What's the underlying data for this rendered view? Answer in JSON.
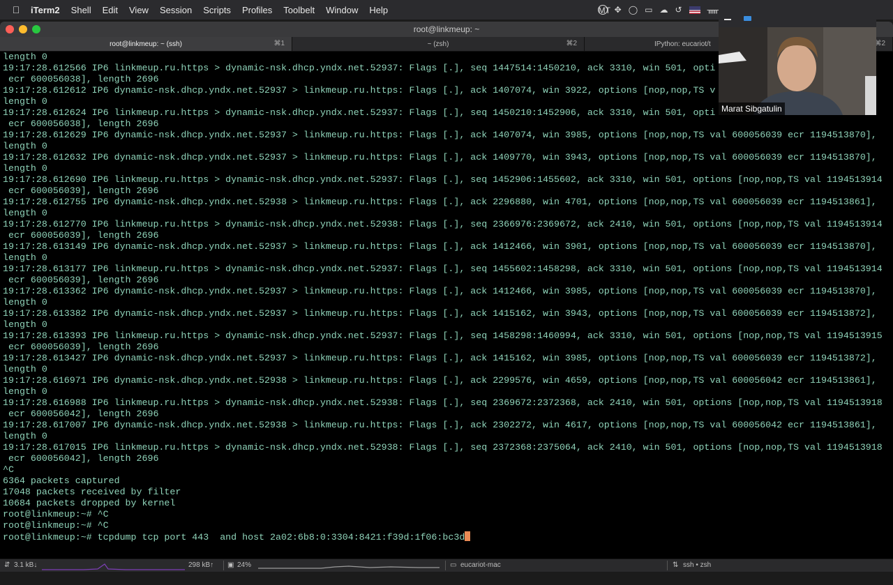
{
  "menubar": {
    "app_name": "iTerm2",
    "items": [
      "Shell",
      "Edit",
      "View",
      "Session",
      "Scripts",
      "Profiles",
      "Toolbelt",
      "Window",
      "Help"
    ],
    "status_badge": "MT"
  },
  "window": {
    "title": "root@linkmeup: ~"
  },
  "tabs": [
    {
      "label": "root@linkmeup: ~ (ssh)",
      "shortcut": "⌘1"
    },
    {
      "label": "~ (zsh)",
      "shortcut": "⌘2"
    },
    {
      "label": "IPython: eucariot/t",
      "shortcut": "⌘2"
    }
  ],
  "terminal": {
    "lines": [
      "length 0",
      "19:17:28.612566 IP6 linkmeup.ru.https > dynamic-nsk.dhcp.yndx.net.52937: Flags [.], seq 1447514:1450210, ack 3310, win 501, opti",
      " ecr 600056038], length 2696",
      "19:17:28.612612 IP6 dynamic-nsk.dhcp.yndx.net.52937 > linkmeup.ru.https: Flags [.], ack 1407074, win 3922, options [nop,nop,TS v",
      "length 0",
      "19:17:28.612624 IP6 linkmeup.ru.https > dynamic-nsk.dhcp.yndx.net.52937: Flags [.], seq 1450210:1452906, ack 3310, win 501, opti",
      " ecr 600056038], length 2696",
      "19:17:28.612629 IP6 dynamic-nsk.dhcp.yndx.net.52937 > linkmeup.ru.https: Flags [.], ack 1407074, win 3985, options [nop,nop,TS val 600056039 ecr 1194513870],",
      "length 0",
      "19:17:28.612632 IP6 dynamic-nsk.dhcp.yndx.net.52937 > linkmeup.ru.https: Flags [.], ack 1409770, win 3943, options [nop,nop,TS val 600056039 ecr 1194513870],",
      "length 0",
      "19:17:28.612690 IP6 linkmeup.ru.https > dynamic-nsk.dhcp.yndx.net.52937: Flags [.], seq 1452906:1455602, ack 3310, win 501, options [nop,nop,TS val 1194513914",
      " ecr 600056039], length 2696",
      "19:17:28.612755 IP6 dynamic-nsk.dhcp.yndx.net.52938 > linkmeup.ru.https: Flags [.], ack 2296880, win 4701, options [nop,nop,TS val 600056039 ecr 1194513861],",
      "length 0",
      "19:17:28.612770 IP6 linkmeup.ru.https > dynamic-nsk.dhcp.yndx.net.52938: Flags [.], seq 2366976:2369672, ack 2410, win 501, options [nop,nop,TS val 1194513914",
      " ecr 600056039], length 2696",
      "19:17:28.613149 IP6 dynamic-nsk.dhcp.yndx.net.52937 > linkmeup.ru.https: Flags [.], ack 1412466, win 3901, options [nop,nop,TS val 600056039 ecr 1194513870],",
      "length 0",
      "19:17:28.613177 IP6 linkmeup.ru.https > dynamic-nsk.dhcp.yndx.net.52937: Flags [.], seq 1455602:1458298, ack 3310, win 501, options [nop,nop,TS val 1194513914",
      " ecr 600056039], length 2696",
      "19:17:28.613362 IP6 dynamic-nsk.dhcp.yndx.net.52937 > linkmeup.ru.https: Flags [.], ack 1412466, win 3985, options [nop,nop,TS val 600056039 ecr 1194513870],",
      "length 0",
      "19:17:28.613382 IP6 dynamic-nsk.dhcp.yndx.net.52937 > linkmeup.ru.https: Flags [.], ack 1415162, win 3943, options [nop,nop,TS val 600056039 ecr 1194513872],",
      "length 0",
      "19:17:28.613393 IP6 linkmeup.ru.https > dynamic-nsk.dhcp.yndx.net.52937: Flags [.], seq 1458298:1460994, ack 3310, win 501, options [nop,nop,TS val 1194513915",
      " ecr 600056039], length 2696",
      "19:17:28.613427 IP6 dynamic-nsk.dhcp.yndx.net.52937 > linkmeup.ru.https: Flags [.], ack 1415162, win 3985, options [nop,nop,TS val 600056039 ecr 1194513872],",
      "length 0",
      "19:17:28.616971 IP6 dynamic-nsk.dhcp.yndx.net.52938 > linkmeup.ru.https: Flags [.], ack 2299576, win 4659, options [nop,nop,TS val 600056042 ecr 1194513861],",
      "length 0",
      "19:17:28.616988 IP6 linkmeup.ru.https > dynamic-nsk.dhcp.yndx.net.52938: Flags [.], seq 2369672:2372368, ack 2410, win 501, options [nop,nop,TS val 1194513918",
      " ecr 600056042], length 2696",
      "19:17:28.617007 IP6 dynamic-nsk.dhcp.yndx.net.52938 > linkmeup.ru.https: Flags [.], ack 2302272, win 4617, options [nop,nop,TS val 600056042 ecr 1194513861],",
      "length 0",
      "19:17:28.617015 IP6 linkmeup.ru.https > dynamic-nsk.dhcp.yndx.net.52938: Flags [.], seq 2372368:2375064, ack 2410, win 501, options [nop,nop,TS val 1194513918",
      " ecr 600056042], length 2696",
      "^C",
      "6364 packets captured",
      "17048 packets received by filter",
      "10684 packets dropped by kernel",
      "root@linkmeup:~# ^C",
      "root@linkmeup:~# ^C"
    ],
    "prompt_line": "root@linkmeup:~# tcpdump tcp port 443  and host 2a02:6b8:0:3304:8421:f39d:1f06:bc3d"
  },
  "statusbar": {
    "net_down": "3.1 kB↓",
    "net_up": "298 kB↑",
    "cpu": "24%",
    "host": "eucariot-mac",
    "session": "ssh • zsh"
  },
  "webcam": {
    "person_name": "Marat Sibgatulin"
  },
  "colors": {
    "terminal_text": "#8fd3b9",
    "cursor": "#e98a54",
    "terminal_bg": "#000000"
  }
}
